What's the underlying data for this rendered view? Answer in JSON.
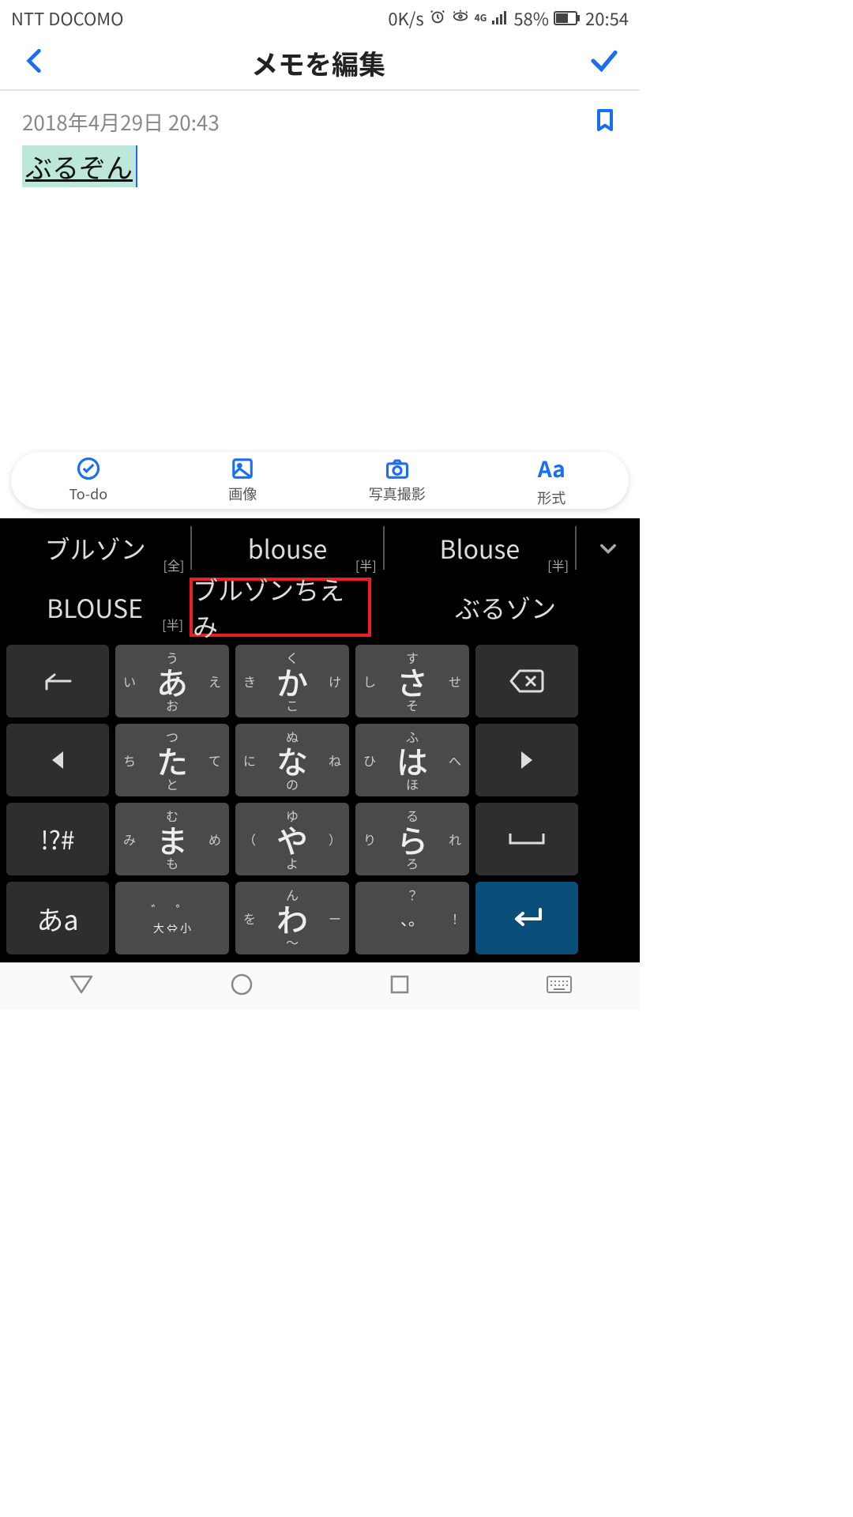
{
  "status": {
    "carrier": "NTT DOCOMO",
    "speed": "0K/s",
    "battery_pct": "58%",
    "time": "20:54"
  },
  "header": {
    "title": "メモを編集"
  },
  "note": {
    "datetime": "2018年4月29日 20:43",
    "composing_text": "ぶるぞん"
  },
  "toolbar": [
    {
      "label": "To-do"
    },
    {
      "label": "画像"
    },
    {
      "label": "写真撮影"
    },
    {
      "label": "形式"
    }
  ],
  "candidates_row1": [
    {
      "text": "ブルゾン",
      "tag": "[全]"
    },
    {
      "text": "blouse",
      "tag": "[半]"
    },
    {
      "text": "Blouse",
      "tag": "[半]"
    }
  ],
  "candidates_row2": [
    {
      "text": "BLOUSE",
      "tag": "[半]"
    },
    {
      "text": "ブルゾンちえみ",
      "highlight": true
    },
    {
      "text": "ぶるゾン"
    }
  ],
  "flick_keys": [
    {
      "main": "あ",
      "t": "う",
      "b": "お",
      "l": "い",
      "r": "え"
    },
    {
      "main": "か",
      "t": "く",
      "b": "こ",
      "l": "き",
      "r": "け"
    },
    {
      "main": "さ",
      "t": "す",
      "b": "そ",
      "l": "し",
      "r": "せ"
    },
    {
      "main": "た",
      "t": "つ",
      "b": "と",
      "l": "ち",
      "r": "て"
    },
    {
      "main": "な",
      "t": "ぬ",
      "b": "の",
      "l": "に",
      "r": "ね"
    },
    {
      "main": "は",
      "t": "ふ",
      "b": "ほ",
      "l": "ひ",
      "r": "へ"
    },
    {
      "main": "ま",
      "t": "む",
      "b": "も",
      "l": "み",
      "r": "め"
    },
    {
      "main": "や",
      "t": "ゆ",
      "b": "よ",
      "l": "（",
      "r": "）"
    },
    {
      "main": "ら",
      "t": "る",
      "b": "ろ",
      "l": "り",
      "r": "れ"
    },
    {
      "main": "わ",
      "t": "ん",
      "b": "〜",
      "l": "を",
      "r": "ー"
    }
  ],
  "size_key_top": "゛  ゜",
  "size_key_bot": "大 ⇔ 小",
  "punct_key": {
    "main": "、。",
    "t": "？",
    "r": "！"
  },
  "sym_key": "!?#",
  "mode_key": "あa"
}
